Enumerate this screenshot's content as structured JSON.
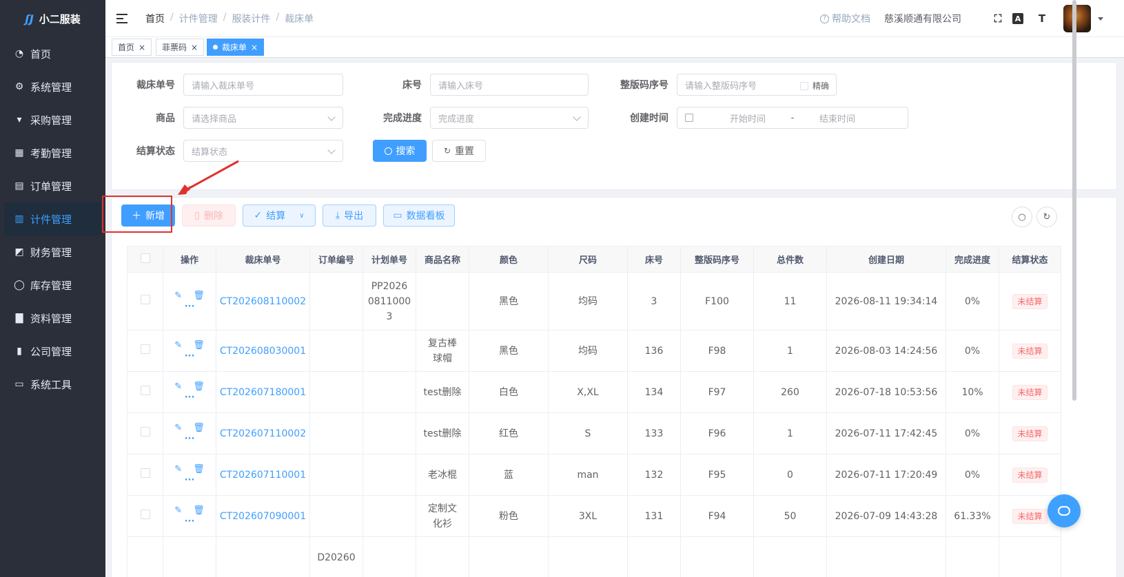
{
  "app": {
    "logo_mark": "ʃJ",
    "name": "小二服装"
  },
  "sidebar": {
    "items": [
      {
        "label": "首页",
        "icon": "dashboard-icon",
        "glyph": "◔"
      },
      {
        "label": "系统管理",
        "icon": "gear-icon",
        "glyph": "⚙"
      },
      {
        "label": "采购管理",
        "icon": "cart-icon",
        "glyph": "▾"
      },
      {
        "label": "考勤管理",
        "icon": "grid-icon",
        "glyph": "▦"
      },
      {
        "label": "订单管理",
        "icon": "order-icon",
        "glyph": "▤"
      },
      {
        "label": "计件管理",
        "icon": "book-icon",
        "glyph": "▥"
      },
      {
        "label": "财务管理",
        "icon": "chart-icon",
        "glyph": "◩"
      },
      {
        "label": "库存管理",
        "icon": "user-icon",
        "glyph": "◯"
      },
      {
        "label": "资料管理",
        "icon": "document-icon",
        "glyph": "▇"
      },
      {
        "label": "公司管理",
        "icon": "bar-chart-icon",
        "glyph": "▮"
      },
      {
        "label": "系统工具",
        "icon": "toolbox-icon",
        "glyph": "▭"
      }
    ]
  },
  "header": {
    "breadcrumb": [
      "首页",
      "计件管理",
      "服装计件",
      "裁床单"
    ],
    "separator": "/",
    "help": "帮助文档",
    "help_glyph": "?",
    "company": "慈溪顺通有限公司",
    "icons": {
      "fullscreen": "⛶",
      "font_size": "A",
      "text_size": "T"
    }
  },
  "tags": [
    {
      "label": "首页",
      "close": "×"
    },
    {
      "label": "菲票码",
      "close": "×"
    },
    {
      "label": "裁床单",
      "close": "×"
    }
  ],
  "search": {
    "cut_no_label": "裁床单号",
    "cut_no_placeholder": "请输入裁床单号",
    "bed_no_label": "床号",
    "bed_no_placeholder": "请输入床号",
    "code_label": "整版码序号",
    "code_placeholder": "请输入整版码序号",
    "exact_label": "精确",
    "goods_label": "商品",
    "goods_placeholder": "请选择商品",
    "progress_label": "完成进度",
    "progress_placeholder": "完成进度",
    "created_label": "创建时间",
    "start_placeholder": "开始时间",
    "range_sep": "-",
    "end_placeholder": "结束时间",
    "settle_label": "结算状态",
    "settle_placeholder": "结算状态",
    "search_btn": "搜索",
    "reset_btn": "重置"
  },
  "toolbar": {
    "add": "新增",
    "delete": "删除",
    "settle": "结算",
    "export": "导出",
    "board": "数据看板"
  },
  "table": {
    "headers": [
      "操作",
      "裁床单号",
      "订单编号",
      "计划单号",
      "商品名称",
      "颜色",
      "尺码",
      "床号",
      "整版码序号",
      "总件数",
      "创建日期",
      "完成进度",
      "结算状态"
    ],
    "rows": [
      {
        "no": "CT202608110002",
        "order": "",
        "plan": "PP2026\n0811000\n3",
        "goods": "",
        "color": "黑色",
        "size": "均码",
        "bed": "3",
        "code": "F100",
        "total": "11",
        "date": "2026-08-11 19:34:14",
        "progress": "0%",
        "status": "未结算"
      },
      {
        "no": "CT202608030001",
        "order": "",
        "plan": "",
        "goods": "复古棒\n球帽",
        "color": "黑色",
        "size": "均码",
        "bed": "136",
        "code": "F98",
        "total": "1",
        "date": "2026-08-03 14:24:56",
        "progress": "0%",
        "status": "未结算"
      },
      {
        "no": "CT202607180001",
        "order": "",
        "plan": "",
        "goods": "test删除",
        "color": "白色",
        "size": "X,XL",
        "bed": "134",
        "code": "F97",
        "total": "260",
        "date": "2026-07-18 10:53:56",
        "progress": "10%",
        "status": "未结算"
      },
      {
        "no": "CT202607110002",
        "order": "",
        "plan": "",
        "goods": "test删除",
        "color": "红色",
        "size": "S",
        "bed": "133",
        "code": "F96",
        "total": "1",
        "date": "2026-07-11 17:42:45",
        "progress": "0%",
        "status": "未结算"
      },
      {
        "no": "CT202607110001",
        "order": "",
        "plan": "",
        "goods": "老冰棍",
        "color": "蓝",
        "size": "man",
        "bed": "132",
        "code": "F95",
        "total": "0",
        "date": "2026-07-11 17:20:49",
        "progress": "0%",
        "status": "未结算"
      },
      {
        "no": "CT202607090001",
        "order": "",
        "plan": "",
        "goods": "定制文\n化衫",
        "color": "粉色",
        "size": "3XL",
        "bed": "131",
        "code": "F94",
        "total": "50",
        "date": "2026-07-09 14:43:28",
        "progress": "61.33%",
        "status": "未结算"
      },
      {
        "no": "",
        "order": "D20260",
        "plan": "",
        "goods": "",
        "color": "",
        "size": "",
        "bed": "",
        "code": "",
        "total": "",
        "date": "",
        "progress": "",
        "status": ""
      }
    ]
  },
  "colors": {
    "primary": "#409eff",
    "sidebar": "#2b2f3a",
    "danger": "#f56c6c",
    "annotation": "#e0312e"
  }
}
